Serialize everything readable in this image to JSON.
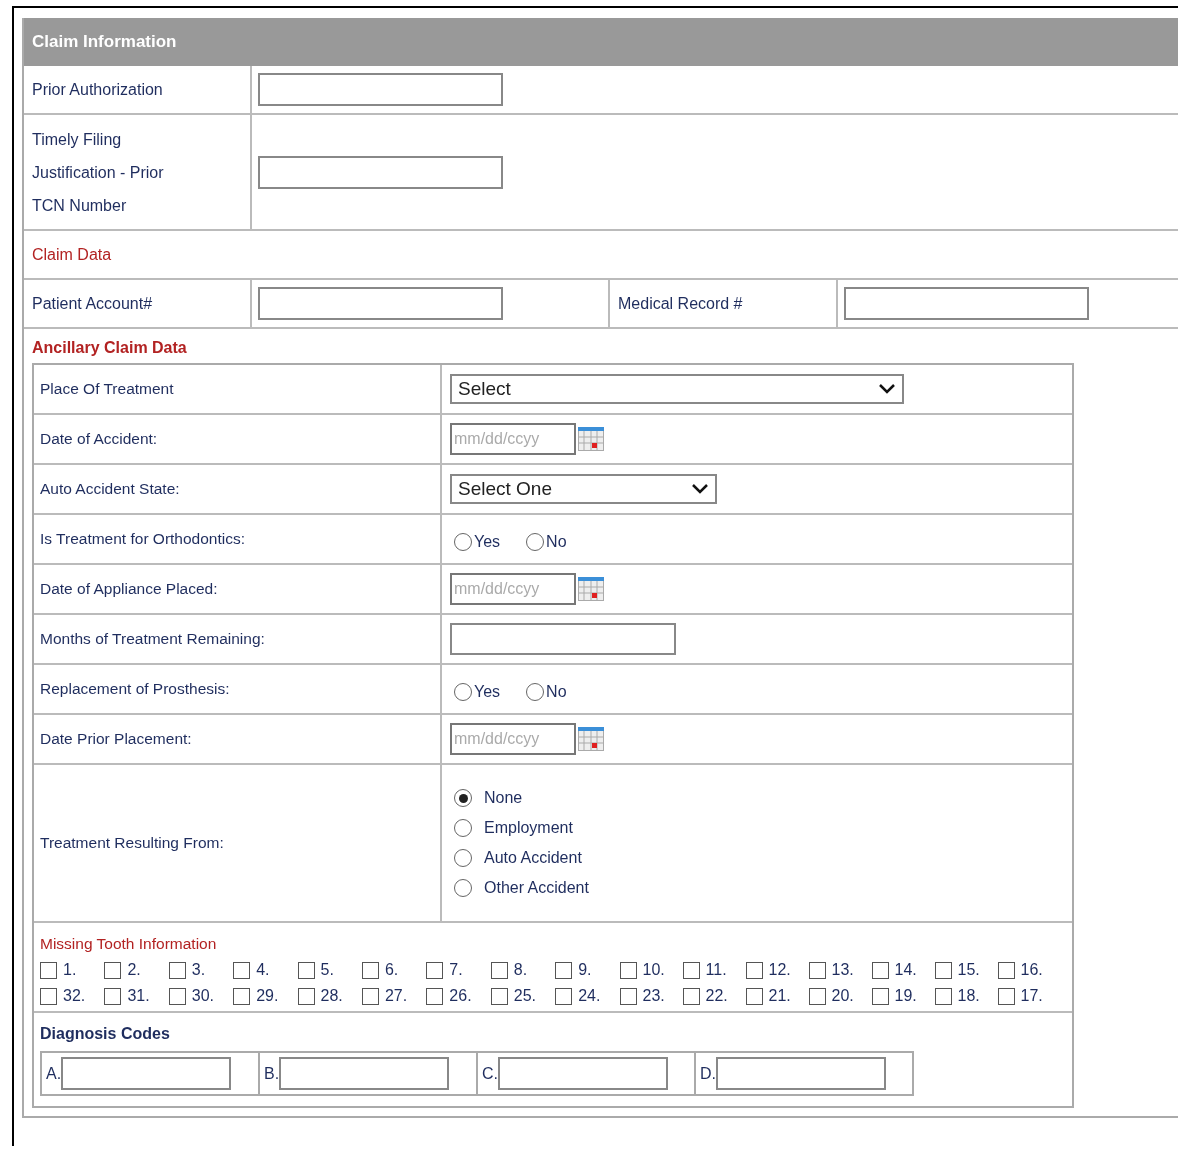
{
  "section_title": "Claim Information",
  "top_fields": [
    {
      "label": "Prior Authorization"
    },
    {
      "label": "Timely Filing Justification - Prior TCN Number"
    }
  ],
  "claim_data": {
    "title": "Claim Data",
    "fields": [
      {
        "label": "Patient Account#"
      },
      {
        "label": "Medical Record #"
      }
    ]
  },
  "ancillary": {
    "title": "Ancillary Claim Data",
    "rows": [
      {
        "label": "Place Of Treatment",
        "kind": "select",
        "value": "Select",
        "wide": true
      },
      {
        "label": "Date of Accident:",
        "kind": "date",
        "placeholder": "mm/dd/ccyy"
      },
      {
        "label": "Auto Accident State:",
        "kind": "select",
        "value": "Select One",
        "wide": false
      },
      {
        "label": "Is Treatment for Orthodontics:",
        "kind": "radio",
        "options": [
          {
            "label": "Yes",
            "selected": false
          },
          {
            "label": "No",
            "selected": false
          }
        ]
      },
      {
        "label": "Date of Appliance Placed:",
        "kind": "date",
        "placeholder": "mm/dd/ccyy"
      },
      {
        "label": "Months of Treatment Remaining:",
        "kind": "text"
      },
      {
        "label": "Replacement of Prosthesis:",
        "kind": "radio",
        "options": [
          {
            "label": "Yes",
            "selected": false
          },
          {
            "label": "No",
            "selected": false
          }
        ]
      },
      {
        "label": "Date Prior Placement:",
        "kind": "date",
        "placeholder": "mm/dd/ccyy"
      },
      {
        "label": "Treatment Resulting From:",
        "kind": "radio_list",
        "options": [
          {
            "label": "None",
            "selected": true
          },
          {
            "label": "Employment",
            "selected": false
          },
          {
            "label": "Auto Accident",
            "selected": false
          },
          {
            "label": "Other Accident",
            "selected": false
          }
        ]
      }
    ]
  },
  "missing_tooth": {
    "title": "Missing Tooth Information",
    "rows": [
      [
        {
          "label": "1.",
          "checked": false
        },
        {
          "label": "2.",
          "checked": false
        },
        {
          "label": "3.",
          "checked": false
        },
        {
          "label": "4.",
          "checked": false
        },
        {
          "label": "5.",
          "checked": false
        },
        {
          "label": "6.",
          "checked": false
        },
        {
          "label": "7.",
          "checked": false
        },
        {
          "label": "8.",
          "checked": false
        },
        {
          "label": "9.",
          "checked": false
        },
        {
          "label": "10.",
          "checked": false
        },
        {
          "label": "11.",
          "checked": false
        },
        {
          "label": "12.",
          "checked": false
        },
        {
          "label": "13.",
          "checked": false
        },
        {
          "label": "14.",
          "checked": false
        },
        {
          "label": "15.",
          "checked": false
        },
        {
          "label": "16.",
          "checked": false
        }
      ],
      [
        {
          "label": "32.",
          "checked": false
        },
        {
          "label": "31.",
          "checked": false
        },
        {
          "label": "30.",
          "checked": false
        },
        {
          "label": "29.",
          "checked": false
        },
        {
          "label": "28.",
          "checked": false
        },
        {
          "label": "27.",
          "checked": false
        },
        {
          "label": "26.",
          "checked": false
        },
        {
          "label": "25.",
          "checked": false
        },
        {
          "label": "24.",
          "checked": false
        },
        {
          "label": "23.",
          "checked": false
        },
        {
          "label": "22.",
          "checked": false
        },
        {
          "label": "21.",
          "checked": false
        },
        {
          "label": "20.",
          "checked": false
        },
        {
          "label": "19.",
          "checked": false
        },
        {
          "label": "18.",
          "checked": false
        },
        {
          "label": "17.",
          "checked": false
        }
      ]
    ]
  },
  "diagnosis": {
    "title": "Diagnosis Codes",
    "codes": [
      {
        "label": "A."
      },
      {
        "label": "B."
      },
      {
        "label": "C."
      },
      {
        "label": "D."
      }
    ]
  }
}
